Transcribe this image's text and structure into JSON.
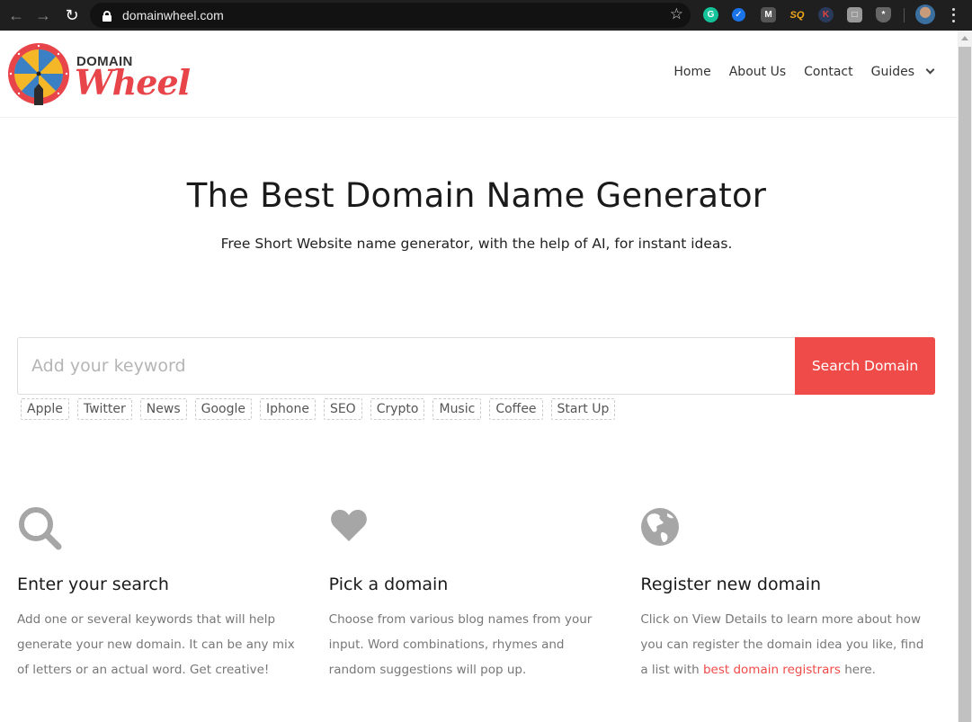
{
  "browser": {
    "url": "domainwheel.com",
    "back_icon": "back-arrow-icon",
    "forward_icon": "forward-arrow-icon",
    "reload_icon": "reload-icon",
    "extensions": [
      "grammarly",
      "check",
      "M",
      "SQ",
      "K",
      "box",
      "shield"
    ]
  },
  "header": {
    "logo_top": "DOMAIN",
    "logo_bottom": "Wheel",
    "nav": [
      {
        "label": "Home"
      },
      {
        "label": "About Us"
      },
      {
        "label": "Contact"
      },
      {
        "label": "Guides"
      }
    ]
  },
  "hero": {
    "title": "The Best Domain Name Generator",
    "subtitle": "Free Short Website name generator, with the help of AI, for instant ideas."
  },
  "search": {
    "placeholder": "Add your keyword",
    "value": "",
    "button_label": "Search Domain"
  },
  "tags": [
    "Apple",
    "Twitter",
    "News",
    "Google",
    "Iphone",
    "SEO",
    "Crypto",
    "Music",
    "Coffee",
    "Start Up"
  ],
  "features": [
    {
      "icon": "search-icon",
      "title": "Enter your search",
      "text": "Add one or several keywords that will help generate your new domain. It can be any mix of letters or an actual word. Get creative!"
    },
    {
      "icon": "heart-icon",
      "title": "Pick a domain",
      "text": "Choose from various blog names from your input. Word combinations, rhymes and random suggestions will pop up."
    },
    {
      "icon": "globe-icon",
      "title": "Register new domain",
      "text_before": "Click on View Details to learn more about how you can register the domain idea you like, find a list with ",
      "link": "best domain registrars",
      "text_after": " here."
    }
  ],
  "colors": {
    "accent": "#ef4b48",
    "icon_gray": "#a6a6a6",
    "body_text": "#777777"
  }
}
